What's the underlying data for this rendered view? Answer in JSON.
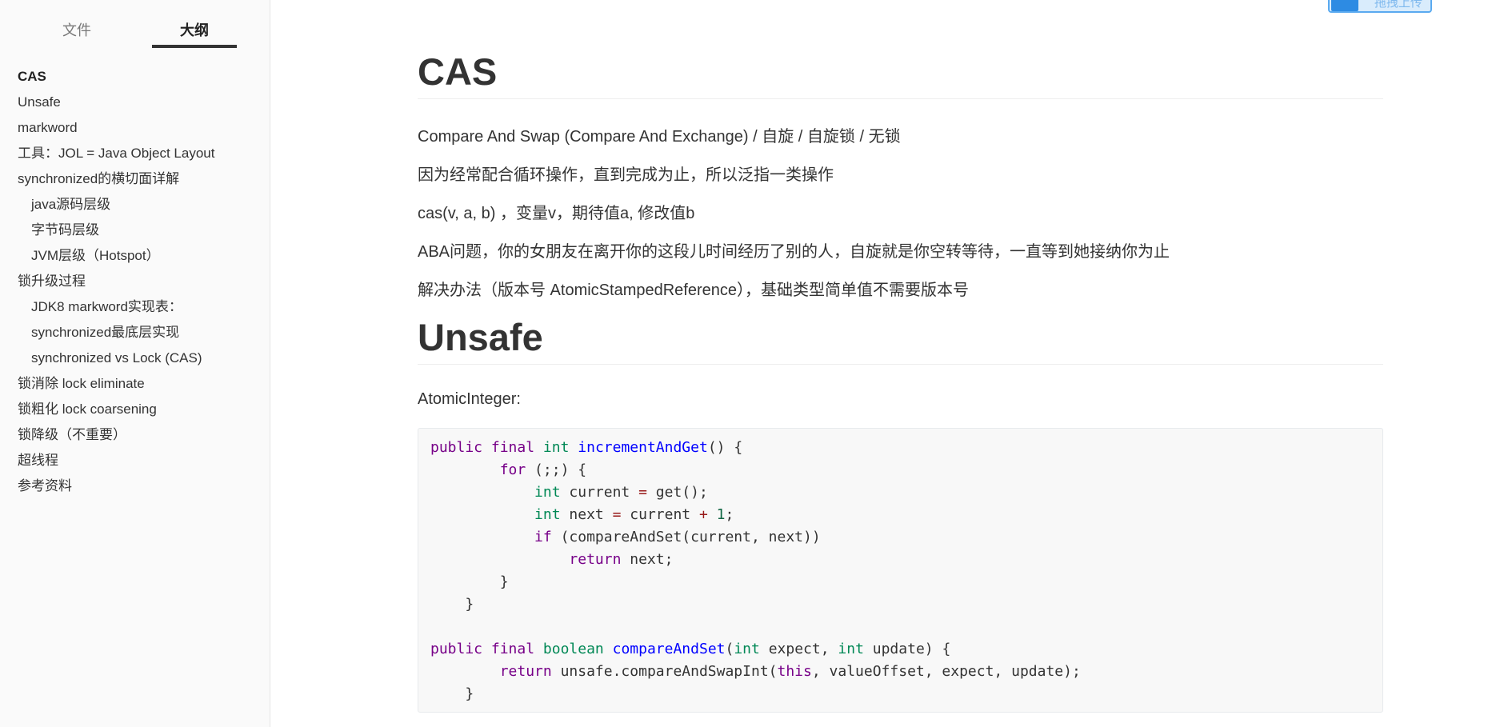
{
  "sidebar": {
    "tabs": {
      "files": "文件",
      "outline": "大纲"
    },
    "outline": [
      "CAS",
      "Unsafe",
      "markword",
      "工具：JOL = Java Object Layout",
      "synchronized的横切面详解",
      "java源码层级",
      "字节码层级",
      "JVM层级（Hotspot）",
      "锁升级过程",
      "JDK8 markword实现表：",
      "synchronized最底层实现",
      "synchronized vs Lock (CAS)",
      "锁消除 lock eliminate",
      "锁粗化 lock coarsening",
      "锁降级（不重要）",
      "超线程",
      "参考资料"
    ]
  },
  "upload_button": {
    "label": "拖拽上传"
  },
  "doc": {
    "h1_cas": "CAS",
    "p1": "Compare And Swap (Compare And Exchange) / 自旋 / 自旋锁 / 无锁",
    "p2": "因为经常配合循环操作，直到完成为止，所以泛指一类操作",
    "p3": "cas(v, a, b) ，变量v，期待值a, 修改值b",
    "p4": "ABA问题，你的女朋友在离开你的这段儿时间经历了别的人，自旋就是你空转等待，一直等到她接纳你为止",
    "p5": "解决办法（版本号 AtomicStampedReference），基础类型简单值不需要版本号",
    "h1_unsafe": "Unsafe",
    "p6": "AtomicInteger:",
    "code": {
      "kw_public": "public",
      "kw_final": "final",
      "t_int": "int",
      "fn_increment": "incrementAndGet",
      "kw_for": "for",
      "kw_if": "if",
      "kw_return": "return",
      "t_boolean": "boolean",
      "fn_compare": "compareAndSet",
      "kw_this": "this",
      "num_one": "1"
    }
  }
}
